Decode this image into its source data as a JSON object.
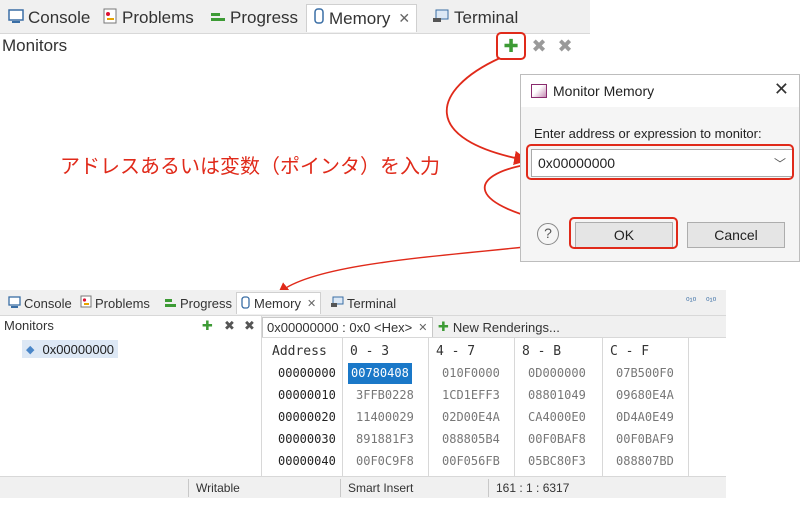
{
  "top_view": {
    "tabs": [
      {
        "label": "Console",
        "icon": "console-icon"
      },
      {
        "label": "Problems",
        "icon": "problems-icon"
      },
      {
        "label": "Progress",
        "icon": "progress-icon"
      },
      {
        "label": "Memory",
        "icon": "memory-icon",
        "active": true,
        "close": "✕"
      },
      {
        "label": "Terminal",
        "icon": "terminal-icon"
      }
    ],
    "monitors_label": "Monitors"
  },
  "annotation": "アドレスあるいは変数（ポインタ）を入力",
  "dialog": {
    "title": "Monitor Memory",
    "close": "✕",
    "label": "Enter address or expression to monitor:",
    "value": "0x00000000",
    "help": "?",
    "ok": "OK",
    "cancel": "Cancel"
  },
  "bottom_view": {
    "tabs": [
      {
        "label": "Console"
      },
      {
        "label": "Problems"
      },
      {
        "label": "Progress"
      },
      {
        "label": "Memory",
        "active": true
      },
      {
        "label": "Terminal"
      }
    ],
    "close": "✕",
    "monitors_label": "Monitors",
    "monitor_item": "0x00000000",
    "rendering_tab": "0x00000000 : 0x0 <Hex>",
    "new_renderings": "New Renderings...",
    "table": {
      "headers": [
        "Address",
        "0 - 3",
        "4 - 7",
        "8 - B",
        "C - F"
      ],
      "rows": [
        [
          "00000000",
          "00780408",
          "010F0000",
          "0D000000",
          "07B500F0"
        ],
        [
          "00000010",
          "3FFB0228",
          "1CD1EFF3",
          "08801049",
          "09680E4A"
        ],
        [
          "00000020",
          "11400029",
          "02D00E4A",
          "CA4000E0",
          "0D4A0E49"
        ],
        [
          "00000030",
          "891881F3",
          "088805B4",
          "00F0BAF8",
          "00F0BAF9"
        ],
        [
          "00000040",
          "00F0C9F8",
          "00F056FB",
          "05BC80F3",
          "088807BD"
        ]
      ]
    },
    "status": {
      "writable": "Writable",
      "insert": "Smart Insert",
      "position": "161 : 1 : 6317"
    }
  },
  "colors": {
    "annotation_red": "#e02a1a",
    "selection_blue": "#1a78c8",
    "plus_green": "#3d9b35"
  }
}
